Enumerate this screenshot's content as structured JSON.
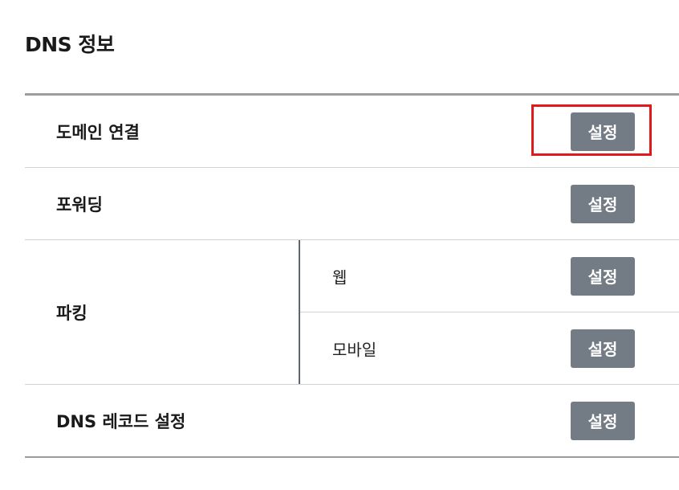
{
  "page": {
    "title": "DNS 정보"
  },
  "rows": {
    "domain": {
      "label": "도메인 연결",
      "button": "설정"
    },
    "forwarding": {
      "label": "포워딩",
      "button": "설정"
    },
    "parking": {
      "label": "파킹",
      "web": {
        "label": "웹",
        "button": "설정"
      },
      "mobile": {
        "label": "모바일",
        "button": "설정"
      }
    },
    "dns_record": {
      "label": "DNS 레코드 설정",
      "button": "설정"
    }
  },
  "colors": {
    "button_bg": "#737b84",
    "highlight": "#e01a1a",
    "divider": "#d2d2d2",
    "table_border": "#9c9c9c"
  }
}
